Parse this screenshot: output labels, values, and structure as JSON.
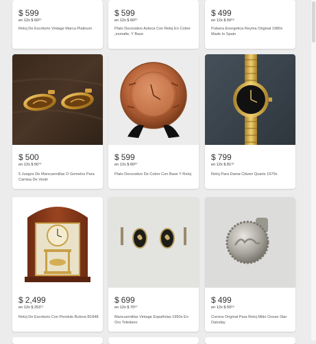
{
  "listings": [
    {
      "price": "599",
      "currency": "$",
      "installments": "en 12x $ 60⁸⁷",
      "title": "Reloj De Escritorio Vintage Marca Platinum",
      "image_icon": "desk-clock-image"
    },
    {
      "price": "599",
      "currency": "$",
      "installments": "en 12x $ 60⁸⁷",
      "title": "Plato Decorativo Azteca Con Reloj En Cobre ,esmalte, Y Base",
      "image_icon": "plate-clock-image"
    },
    {
      "price": "499",
      "currency": "$",
      "installments": "en 12x $ 50⁶⁶",
      "title": "Pulsera Energetica Reyma Original 1980s Made In Spain",
      "image_icon": "bracelet-image"
    },
    {
      "price": "500",
      "currency": "$",
      "installments": "en 12x $ 50⁷⁴",
      "title": "5 Juegos De Mancuernillas O Gemelos Para Camisa De Vestir",
      "image_icon": "cufflinks-gold-image"
    },
    {
      "price": "599",
      "currency": "$",
      "installments": "en 12x $ 60⁸⁷",
      "title": "Plato Decorativo De Cobre Con Base Y Reloj",
      "image_icon": "copper-plate-image"
    },
    {
      "price": "799",
      "currency": "$",
      "installments": "en 12x $ 81¹³",
      "title": "Reloj Para Dama Citizen Quartz 1970s",
      "image_icon": "wristwatch-image"
    },
    {
      "price": "2,499",
      "currency": "$",
      "installments": "en 12x $ 253⁷¹",
      "title": "Reloj De Escritorio Con Pendulo Bulova B1848",
      "image_icon": "pendulum-clock-image"
    },
    {
      "price": "699",
      "currency": "$",
      "installments": "en 12x $ 70⁹⁷",
      "title": "Mancuernillas Vintage Españolas 1950s En Oro Toledano",
      "image_icon": "cufflinks-vintage-image"
    },
    {
      "price": "499",
      "currency": "$",
      "installments": "en 12x $ 50⁶⁶",
      "title": "Corona Original Para Reloj Mido Ocean Star Datoday",
      "image_icon": "watch-crown-image"
    }
  ]
}
